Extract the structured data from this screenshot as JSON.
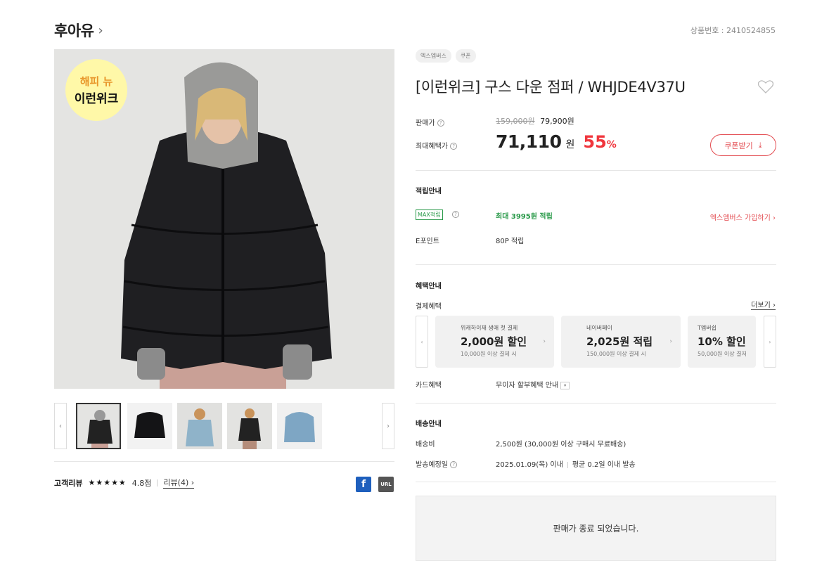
{
  "brand": {
    "name": "후아유",
    "chevron": "›"
  },
  "product_number": "상품번호 : 2410524855",
  "main_image": {
    "badge_line1": "해피 뉴",
    "badge_line2": "이런위크"
  },
  "thumbs": {
    "prev": "‹",
    "next": "›",
    "count": 5
  },
  "reviews": {
    "label": "고객리뷰",
    "stars": "★★★★★",
    "score": "4.8점",
    "link": "리뷰(4) ›"
  },
  "share": {
    "facebook": "f",
    "url": "URL"
  },
  "tags": [
    "엑스엠버스",
    "쿠폰"
  ],
  "title": "[이런위크] 구스 다운 점퍼 / WHJDE4V37U",
  "price": {
    "sale_label": "판매가",
    "original": "159,000원",
    "sale": "79,900원",
    "max_label": "최대혜택가",
    "max_value": "71,110",
    "won": "원",
    "discount": "55",
    "percent": "%",
    "coupon_btn": "쿠폰받기",
    "coupon_icon": "⤓"
  },
  "points": {
    "section": "적립안내",
    "max_badge": "MAX적립",
    "max_value": "최대 3995원 적립",
    "join_link": "엑스엠버스 가입하기 ›",
    "epoint_label": "E포인트",
    "epoint_value": "80P 적립"
  },
  "benefits": {
    "section": "혜택안내",
    "pay_label": "결제혜택",
    "more": "더보기 ›",
    "cards": [
      {
        "title": "위캐하이재 생애 첫 결제",
        "main": "2,000원 할인",
        "sub": "10,000원 이상 결제 시"
      },
      {
        "title": "네이버페이",
        "main": "2,025원 적립",
        "sub": "150,000원 이상 결제 시"
      },
      {
        "title": "T멤버쉽",
        "main": "10% 할인",
        "sub": "50,000원 이상 결저"
      }
    ],
    "card_label": "카드혜택",
    "card_value": "무이자 할부혜택 안내",
    "card_select": "▾"
  },
  "shipping": {
    "section": "배송안내",
    "fee_label": "배송비",
    "fee_value": "2,500원 (30,000원 이상 구매시 무료배송)",
    "date_label": "발송예정일",
    "date_value": "2025.01.09(목) 이내",
    "avg_value": "평균 0.2일 이내 발송"
  },
  "soldout": "판매가 종료 되었습니다."
}
